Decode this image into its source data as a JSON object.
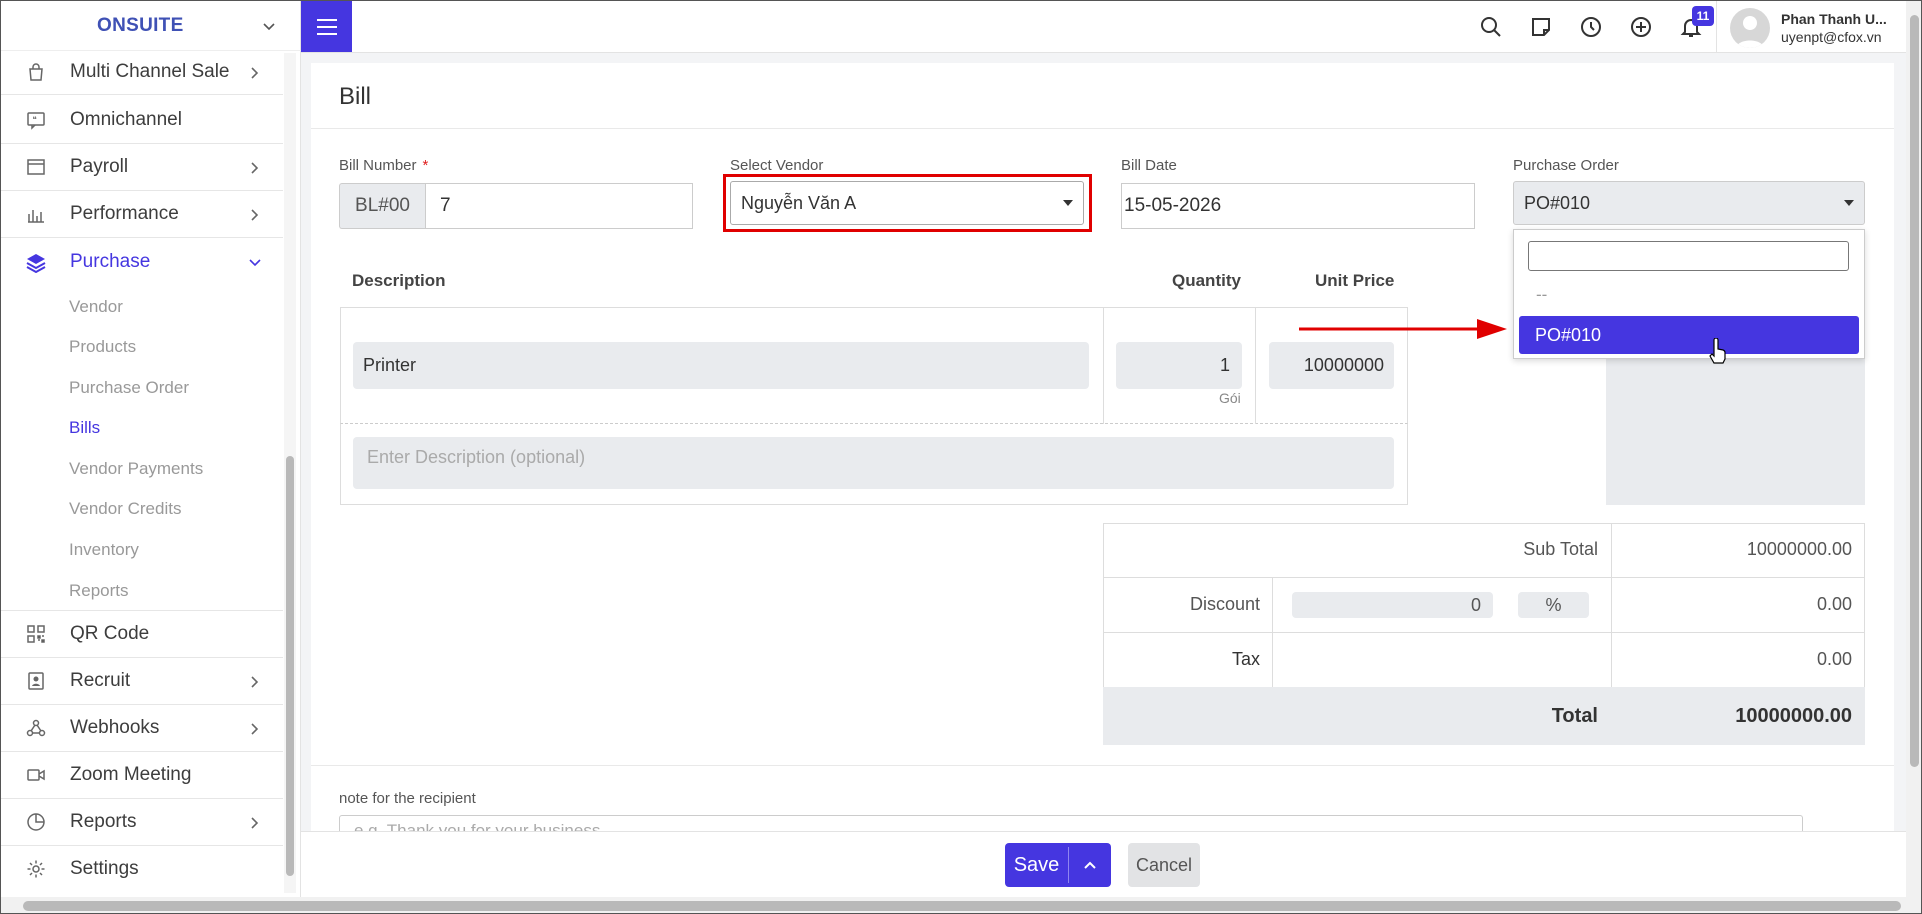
{
  "brand": {
    "name": "ONSUITE"
  },
  "sidebar": {
    "items": [
      {
        "label": "Multi Channel Sale",
        "icon": "shopping-bag-icon"
      },
      {
        "label": "Omnichannel",
        "icon": "chat-quote-icon"
      },
      {
        "label": "Payroll",
        "icon": "window-icon"
      },
      {
        "label": "Performance",
        "icon": "bar-chart-icon"
      },
      {
        "label": "Purchase",
        "icon": "layers-icon"
      },
      {
        "label": "QR Code",
        "icon": "qr-code-icon"
      },
      {
        "label": "Recruit",
        "icon": "id-badge-icon"
      },
      {
        "label": "Webhooks",
        "icon": "webhook-icon"
      },
      {
        "label": "Zoom Meeting",
        "icon": "video-camera-icon"
      },
      {
        "label": "Reports",
        "icon": "pie-chart-icon"
      },
      {
        "label": "Settings",
        "icon": "gear-icon"
      }
    ],
    "purchase_sub": [
      "Vendor",
      "Products",
      "Purchase Order",
      "Bills",
      "Vendor Payments",
      "Vendor Credits",
      "Inventory",
      "Reports"
    ]
  },
  "topbar": {
    "notification_count": "11",
    "user_name": "Phan Thanh U...",
    "user_email": "uyenpt@cfox.vn"
  },
  "page": {
    "title": "Bill"
  },
  "form": {
    "bill_number_label": "Bill Number",
    "bill_number_required": "*",
    "bill_number_prefix": "BL#00",
    "bill_number_value": "7",
    "vendor_label": "Select Vendor",
    "vendor_value": "Nguyễn Văn A",
    "bill_date_label": "Bill Date",
    "bill_date_value": "15-05-2026",
    "po_label": "Purchase Order",
    "po_value": "PO#010"
  },
  "po_dropdown": {
    "search_value": "",
    "none_option": "--",
    "options": [
      "PO#010"
    ]
  },
  "table": {
    "headers": {
      "description": "Description",
      "quantity": "Quantity",
      "unit_price": "Unit Price"
    },
    "rows": [
      {
        "description": "Printer",
        "quantity": "1",
        "unit": "Gói",
        "unit_price": "10000000"
      }
    ],
    "description_placeholder": "Enter Description (optional)"
  },
  "totals": {
    "sub_total_label": "Sub Total",
    "sub_total_value": "10000000.00",
    "discount_label": "Discount",
    "discount_input": "0",
    "discount_unit": "%",
    "discount_value": "0.00",
    "tax_label": "Tax",
    "tax_value": "0.00",
    "total_label": "Total",
    "total_value": "10000000.00"
  },
  "note": {
    "label": "note for the recipient",
    "placeholder": "e.g. Thank you for your business"
  },
  "actions": {
    "save": "Save",
    "cancel": "Cancel"
  },
  "colors": {
    "accent": "#4536e0",
    "highlight": "#e00000"
  }
}
